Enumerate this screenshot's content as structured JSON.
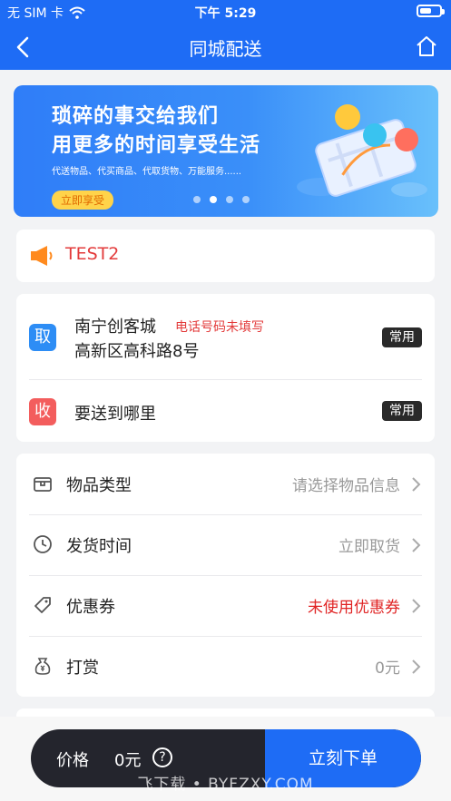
{
  "status": {
    "carrier": "无 SIM 卡",
    "time": "下午 5:29"
  },
  "nav": {
    "title": "同城配送"
  },
  "banner": {
    "line1": "琐碎的事交给我们",
    "line2": "用更多的时间享受生活",
    "subtitle": "代送物品、代买商品、代取货物、万能服务......",
    "cta": "立即享受"
  },
  "notice": {
    "text": "TEST2"
  },
  "pickup": {
    "badge": "取",
    "name": "南宁创客城",
    "warning": "电话号码未填写",
    "detail": "高新区高科路8号",
    "tag": "常用"
  },
  "receive": {
    "badge": "收",
    "text": "要送到哪里",
    "tag": "常用"
  },
  "options": [
    {
      "label": "物品类型",
      "value": "请选择物品信息",
      "icon": "package-icon"
    },
    {
      "label": "发货时间",
      "value": "立即取货",
      "icon": "clock-icon"
    },
    {
      "label": "优惠券",
      "value": "未使用优惠券",
      "icon": "tag-icon",
      "highlight": "#e02424"
    },
    {
      "label": "打赏",
      "value": "0元",
      "icon": "money-bag-icon"
    }
  ],
  "bottom": {
    "price_label": "价格",
    "price": "0元",
    "help": "?",
    "submit": "立刻下单",
    "watermark": "飞下载 • BYFZXY.COM"
  },
  "colors": {
    "primary": "#1e6cf5",
    "danger": "#e33b3b",
    "dark": "#24252d"
  }
}
